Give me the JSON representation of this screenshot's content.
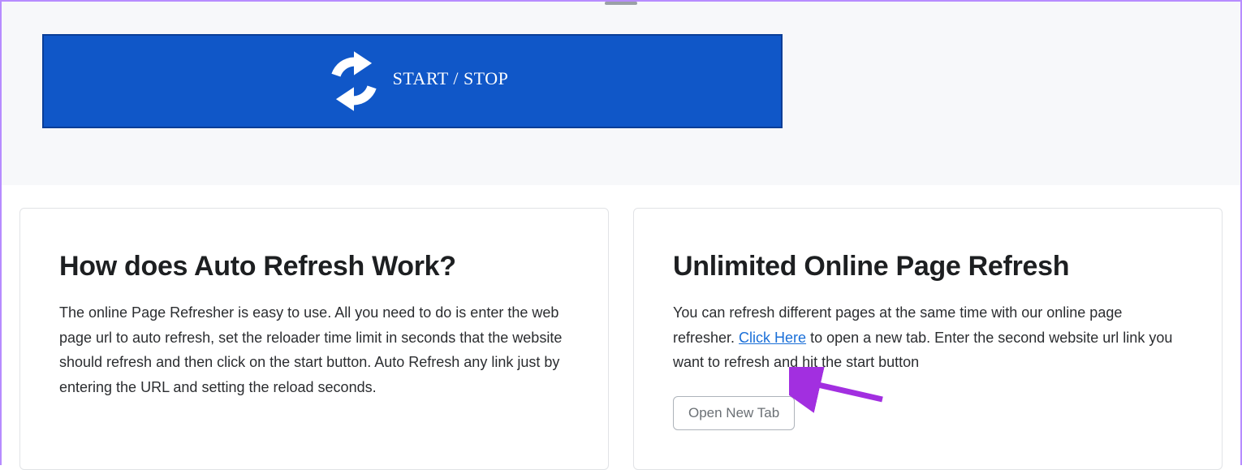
{
  "header": {
    "start_stop_label": "START / STOP"
  },
  "cards": {
    "left": {
      "title": "How does Auto Refresh Work?",
      "body": "The online Page Refresher is easy to use. All you need to do is enter the web page url to auto refresh, set the reloader time limit in seconds that the website should refresh and then click on the start button. Auto Refresh any link just by entering the URL and setting the reload seconds."
    },
    "right": {
      "title": "Unlimited Online Page Refresh",
      "body_before_link": "You can refresh different pages at the same time with our online page refresher. ",
      "link_text": "Click Here",
      "body_after_link": " to open a new tab. Enter the second website url link you want to refresh and hit the start button",
      "open_tab_label": "Open New Tab"
    }
  }
}
